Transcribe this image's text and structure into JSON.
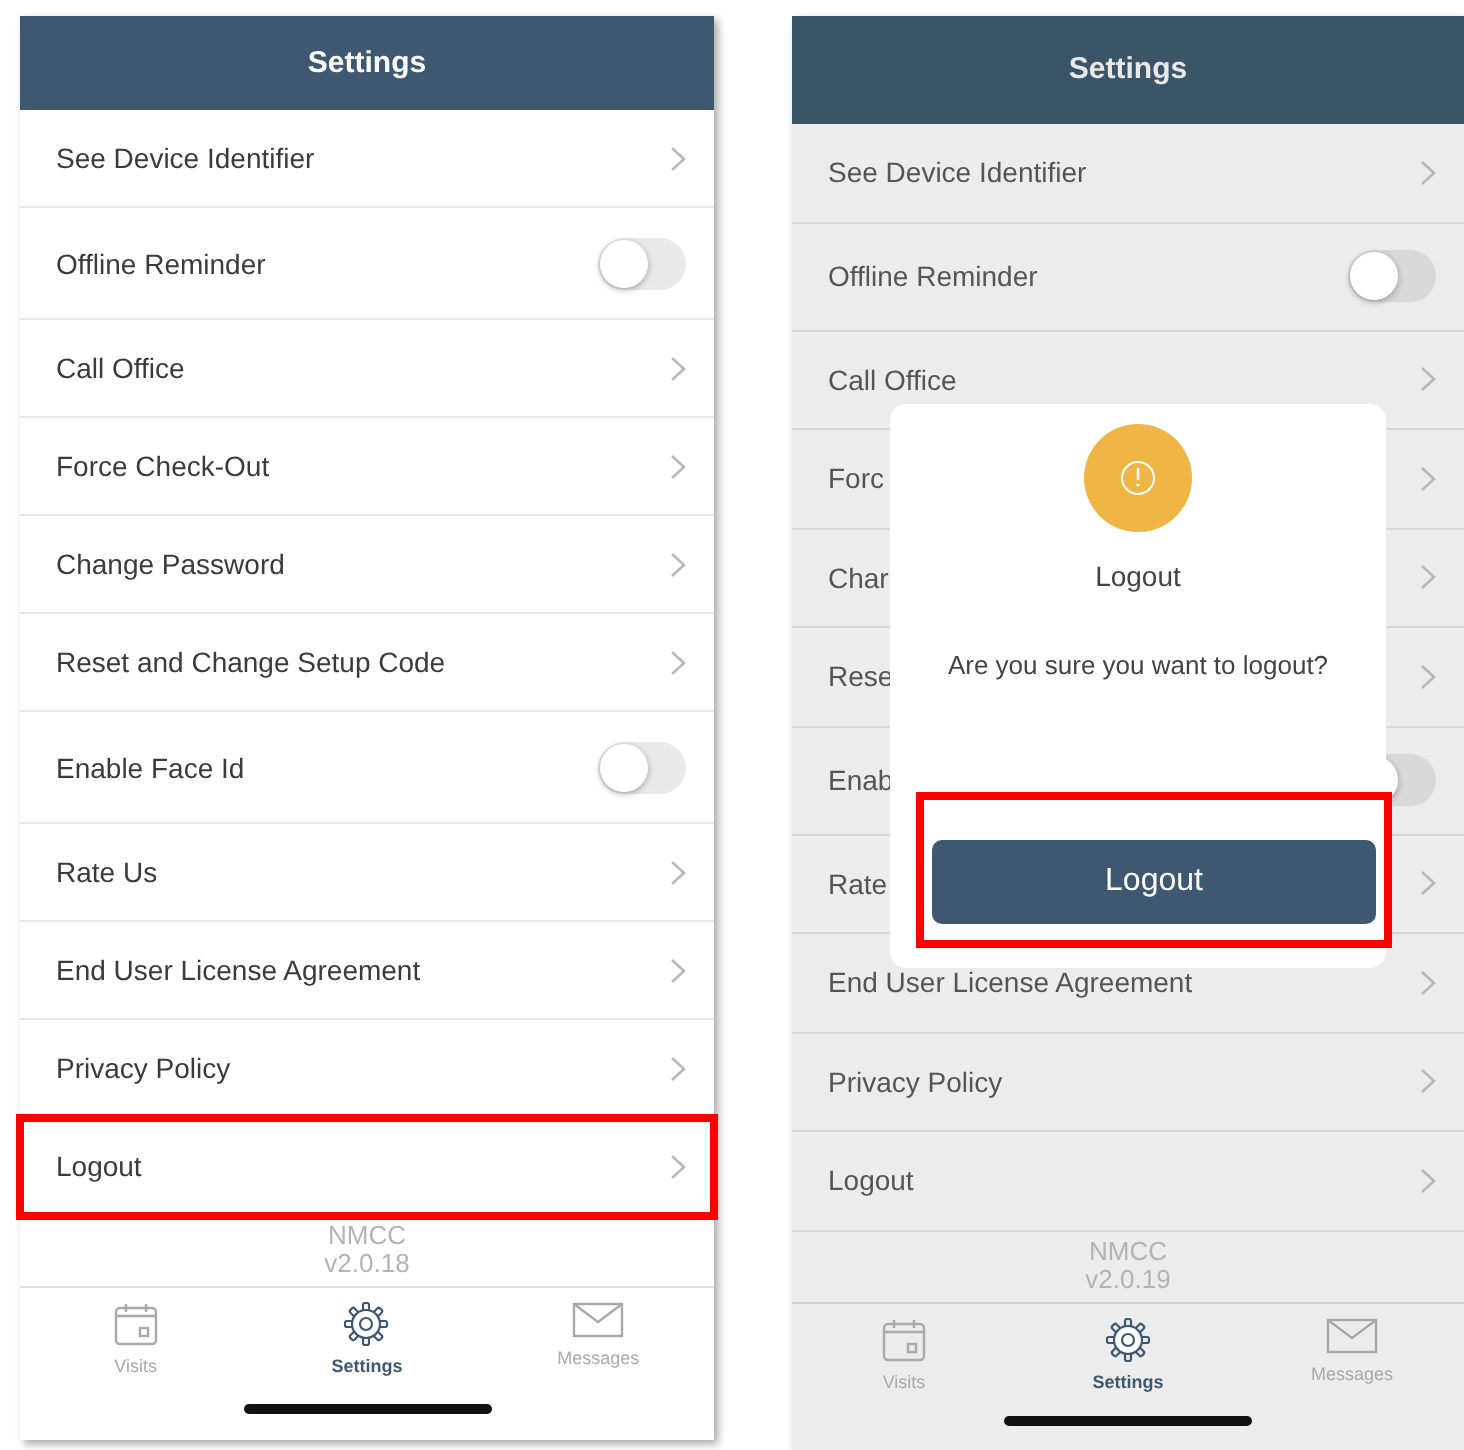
{
  "screens": [
    {
      "title": "Settings",
      "dimmed": false,
      "items": [
        {
          "kind": "link",
          "label": "See Device Identifier",
          "highlighted": false
        },
        {
          "kind": "toggle",
          "label": "Offline Reminder",
          "on": false,
          "highlighted": false
        },
        {
          "kind": "link",
          "label": "Call Office",
          "highlighted": false
        },
        {
          "kind": "link",
          "label": "Force Check-Out",
          "highlighted": false
        },
        {
          "kind": "link",
          "label": "Change Password",
          "highlighted": false
        },
        {
          "kind": "link",
          "label": "Reset and Change Setup Code",
          "highlighted": false
        },
        {
          "kind": "toggle",
          "label": "Enable Face Id",
          "on": false,
          "highlighted": false
        },
        {
          "kind": "link",
          "label": "Rate Us",
          "highlighted": false
        },
        {
          "kind": "link",
          "label": "End User License Agreement",
          "highlighted": false
        },
        {
          "kind": "link",
          "label": "Privacy Policy",
          "highlighted": false
        },
        {
          "kind": "link",
          "label": "Logout",
          "highlighted": true
        }
      ],
      "footer": {
        "app_name": "NMCC",
        "version": "v2.0.18"
      },
      "tabs": [
        {
          "label": "Visits",
          "selected": false
        },
        {
          "label": "Settings",
          "selected": true
        },
        {
          "label": "Messages",
          "selected": false
        }
      ]
    },
    {
      "title": "Settings",
      "dimmed": true,
      "items": [
        {
          "kind": "link",
          "label": "See Device Identifier",
          "highlighted": false
        },
        {
          "kind": "toggle",
          "label": "Offline Reminder",
          "on": false,
          "highlighted": false
        },
        {
          "kind": "link",
          "label": "Call Office",
          "highlighted": false
        },
        {
          "kind": "link",
          "label": "Forc",
          "highlighted": false
        },
        {
          "kind": "link",
          "label": "Char",
          "highlighted": false
        },
        {
          "kind": "link",
          "label": "Rese",
          "highlighted": false
        },
        {
          "kind": "toggle",
          "label": "Enab",
          "on": false,
          "highlighted": false
        },
        {
          "kind": "link",
          "label": "Rate",
          "highlighted": false
        },
        {
          "kind": "link",
          "label": "End User License Agreement",
          "highlighted": false
        },
        {
          "kind": "link",
          "label": "Privacy Policy",
          "highlighted": false
        },
        {
          "kind": "link",
          "label": "Logout",
          "highlighted": false
        }
      ],
      "footer": {
        "app_name": "NMCC",
        "version": "v2.0.19"
      },
      "tabs": [
        {
          "label": "Visits",
          "selected": false
        },
        {
          "label": "Settings",
          "selected": true
        },
        {
          "label": "Messages",
          "selected": false
        }
      ],
      "dialog": {
        "title": "Logout",
        "message": "Are you sure you want to logout?",
        "button": "Logout",
        "button_highlighted": true
      }
    }
  ]
}
